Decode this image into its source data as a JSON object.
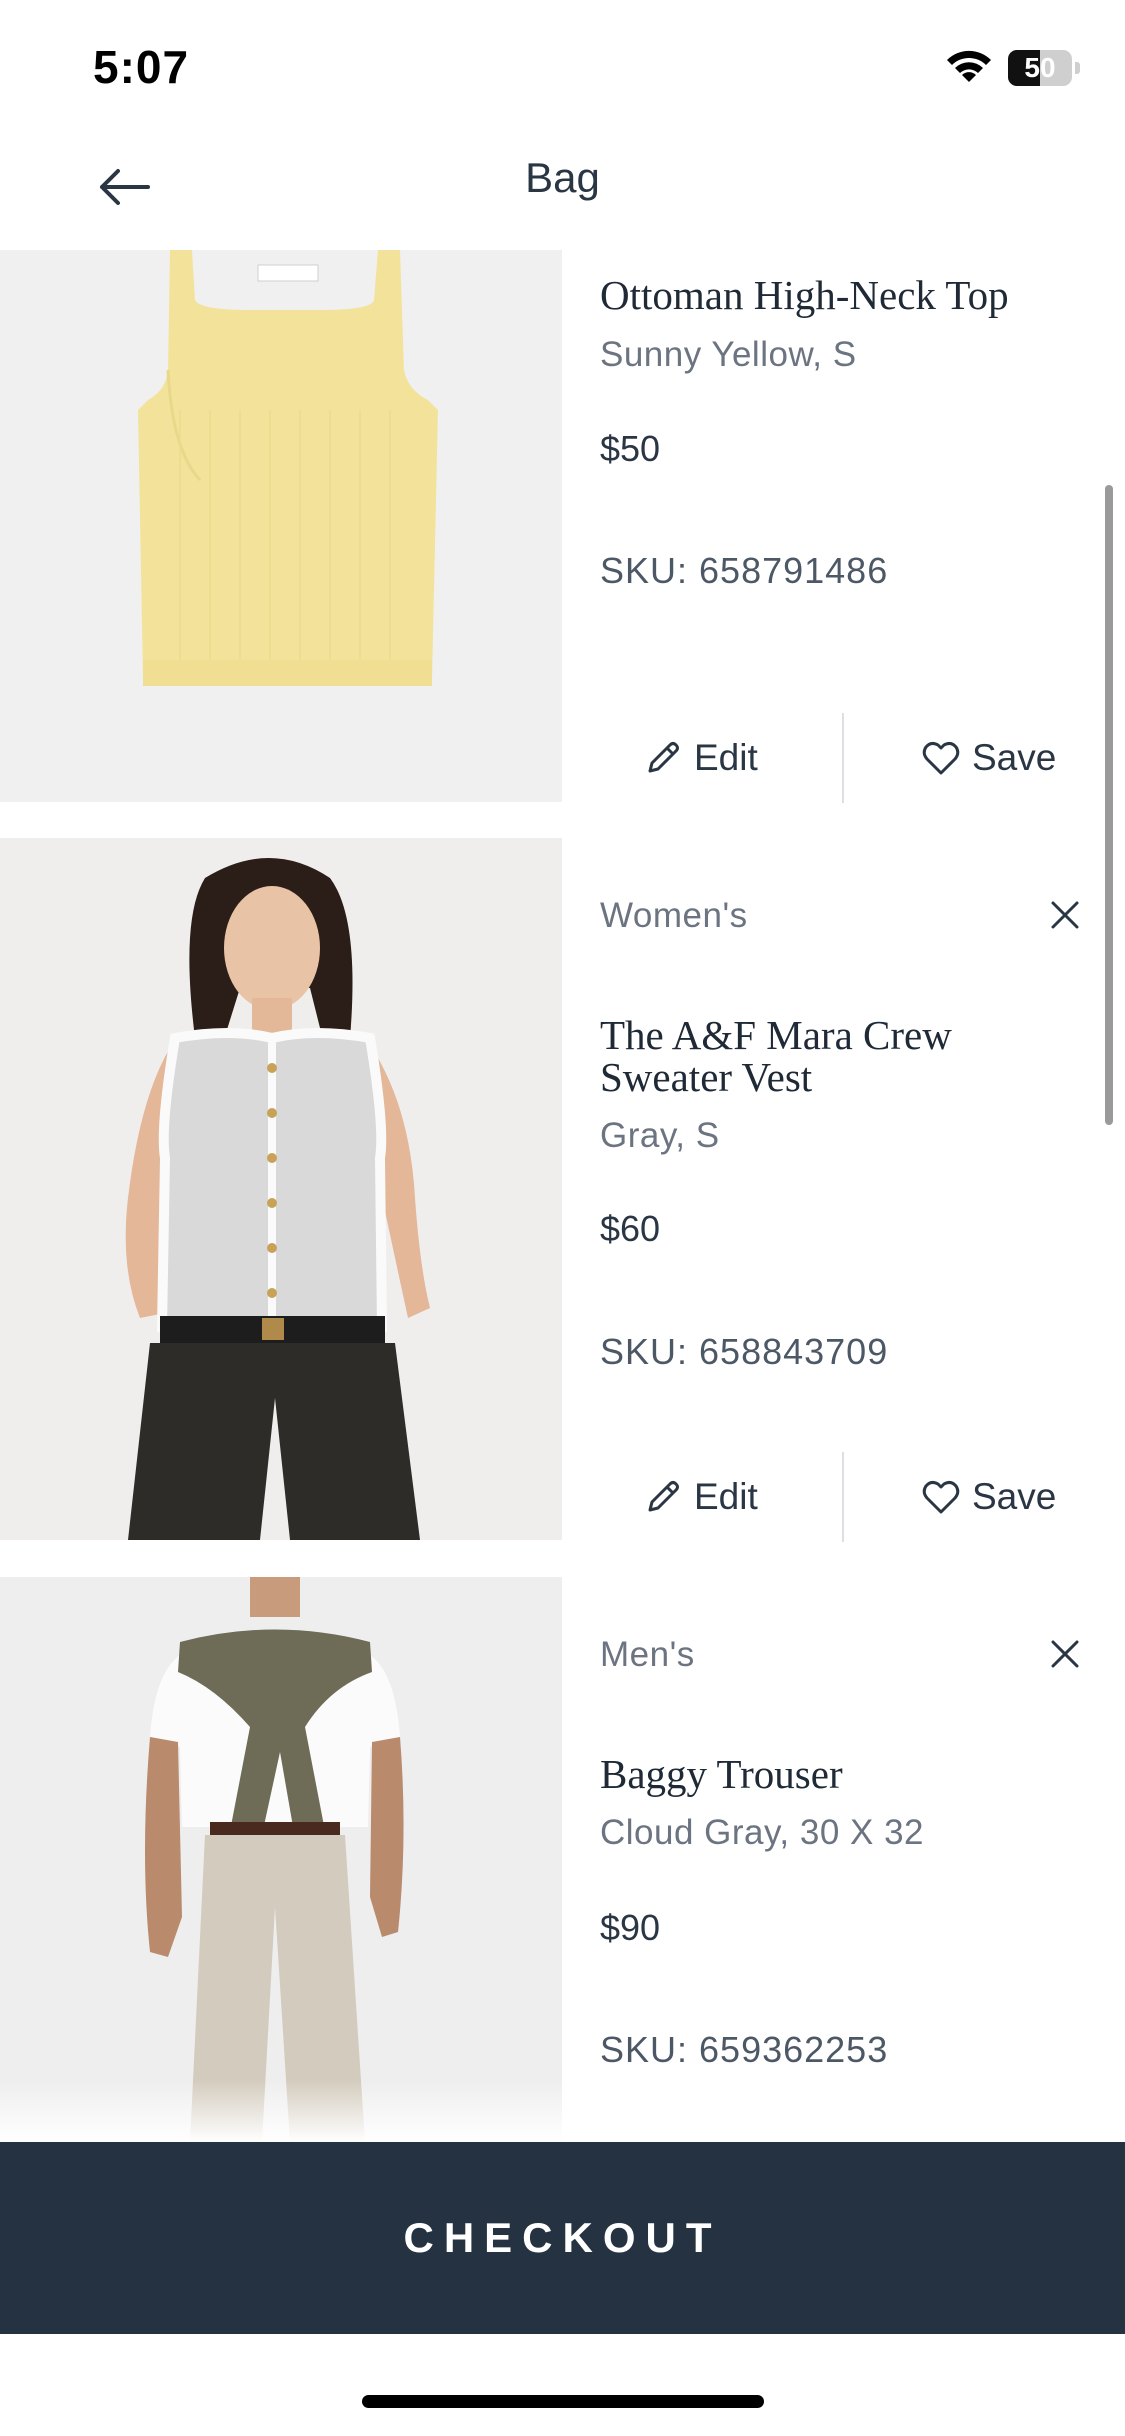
{
  "status_bar": {
    "time": "5:07",
    "battery": "50",
    "battery_level": 0.5
  },
  "header": {
    "title": "Bag"
  },
  "items": [
    {
      "category": "",
      "name": "Ottoman High-Neck Top",
      "variant": "Sunny Yellow, S",
      "price": "$50",
      "sku": "SKU: 658791486",
      "edit_label": "Edit",
      "save_label": "Save"
    },
    {
      "category": "Women's",
      "name": "The A&F Mara Crew Sweater Vest",
      "variant": "Gray, S",
      "price": "$60",
      "sku": "SKU: 658843709",
      "edit_label": "Edit",
      "save_label": "Save"
    },
    {
      "category": "Men's",
      "name": "Baggy Trouser",
      "variant": "Cloud Gray, 30 X 32",
      "price": "$90",
      "sku": "SKU: 659362253"
    }
  ],
  "checkout": {
    "label": "CHECKOUT"
  },
  "colors": {
    "checkout_bg": "#253241",
    "text_primary": "#1f2a36",
    "text_secondary": "#6b7480",
    "photo_bg": "#efefef"
  },
  "icons": [
    "wifi-icon",
    "battery-icon",
    "back-arrow-icon",
    "pencil-icon",
    "heart-icon",
    "close-icon"
  ]
}
